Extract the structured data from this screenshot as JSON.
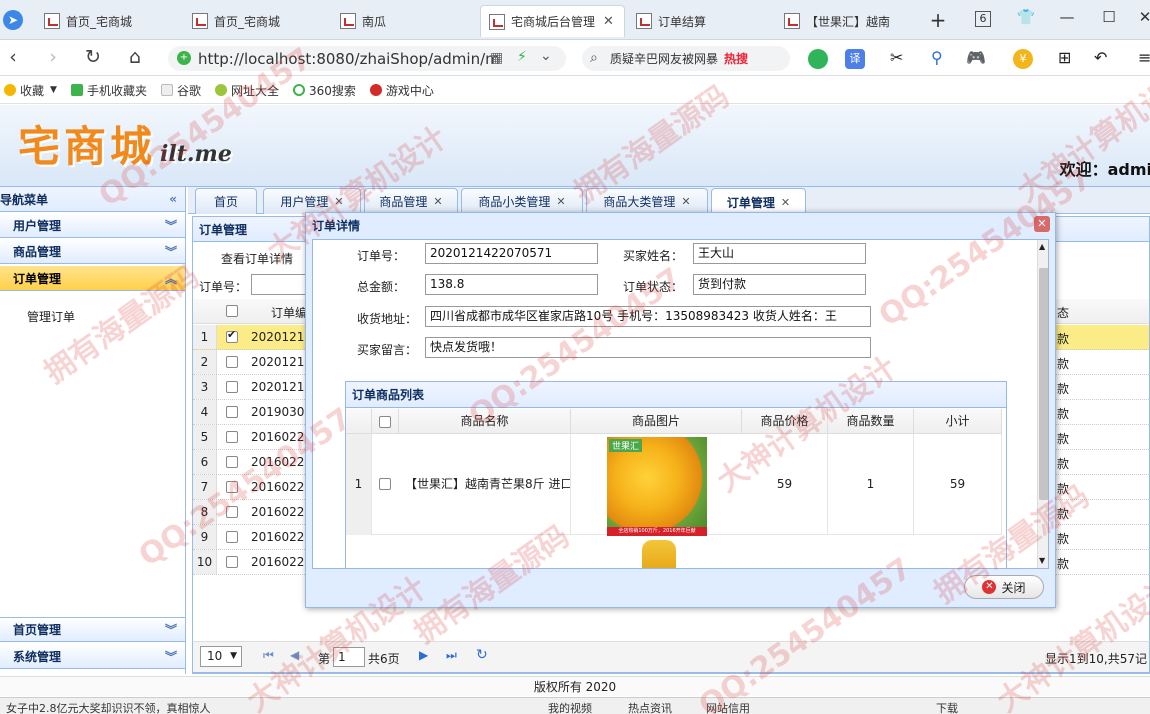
{
  "browser": {
    "tabs": [
      {
        "label": "首页_宅商城",
        "active": false
      },
      {
        "label": "首页_宅商城",
        "active": false
      },
      {
        "label": "南瓜",
        "active": false
      },
      {
        "label": "宅商城后台管理",
        "active": true
      },
      {
        "label": "订单结算",
        "active": false
      },
      {
        "label": "【世果汇】越南",
        "active": false
      }
    ],
    "tab_count": "6",
    "url": "http://localhost:8080/zhaiShop/admin/m",
    "search_text": "质疑辛巴网友被网暴",
    "search_hot": "热搜",
    "bookmarks": [
      "收藏",
      "手机收藏夹",
      "谷歌",
      "网址大全",
      "360搜索",
      "游戏中心"
    ]
  },
  "header": {
    "logo_text": "宅商城",
    "logo_sub": "ilt.me",
    "welcome": "欢迎：admi"
  },
  "left_menu": {
    "title": "导航菜单",
    "groups": [
      {
        "label": "用户管理"
      },
      {
        "label": "商品管理"
      },
      {
        "label": "订单管理"
      },
      {
        "label": "首页管理"
      },
      {
        "label": "系统管理"
      }
    ],
    "sub_item": "管理订单"
  },
  "main_tabs": [
    {
      "label": "首页",
      "closable": false
    },
    {
      "label": "用户管理",
      "closable": true
    },
    {
      "label": "商品管理",
      "closable": true
    },
    {
      "label": "商品小类管理",
      "closable": true
    },
    {
      "label": "商品大类管理",
      "closable": true
    },
    {
      "label": "订单管理",
      "closable": true
    }
  ],
  "order_panel": {
    "title": "订单管理",
    "view_detail": "查看订单详情",
    "order_no_label": "订单号：",
    "col_code": "订单编",
    "col_status": "态",
    "rows": [
      {
        "n": "1",
        "code": "2020121",
        "status": "款",
        "checked": true
      },
      {
        "n": "2",
        "code": "2020121",
        "status": "款",
        "checked": false
      },
      {
        "n": "3",
        "code": "2020121",
        "status": "款",
        "checked": false
      },
      {
        "n": "4",
        "code": "2019030",
        "status": "款",
        "checked": false
      },
      {
        "n": "5",
        "code": "2016022",
        "status": "款",
        "checked": false
      },
      {
        "n": "6",
        "code": "2016022",
        "status": "款",
        "checked": false
      },
      {
        "n": "7",
        "code": "2016022",
        "status": "款",
        "checked": false
      },
      {
        "n": "8",
        "code": "2016022",
        "status": "款",
        "checked": false
      },
      {
        "n": "9",
        "code": "2016022",
        "status": "款",
        "checked": false
      },
      {
        "n": "10",
        "code": "2016022",
        "status": "款",
        "checked": false
      }
    ]
  },
  "pager": {
    "page_size": "10",
    "page_prefix": "第",
    "page_value": "1",
    "page_total": "共6页",
    "summary": "显示1到10,共57记"
  },
  "footer": {
    "copyright": "版权所有 2020"
  },
  "statusbar": {
    "left": "女子中2.8亿元大奖却识识不领，真相惊人",
    "items": [
      "我的视频",
      "热点资讯",
      "网站信用",
      "下载"
    ]
  },
  "modal": {
    "title": "订单详情",
    "fields": {
      "order_no_label": "订单号：",
      "order_no": "2020121422070571",
      "buyer_label": "买家姓名：",
      "buyer": "王大山",
      "total_label": "总金额：",
      "total": "138.8",
      "status_label": "订单状态：",
      "status": "货到付款",
      "address_label": "收货地址：",
      "address": "四川省成都市成华区崔家店路10号  手机号：13508983423  收货人姓名：王",
      "message_label": "买家留言：",
      "message": "快点发货哦！"
    },
    "goods": {
      "title": "订单商品列表",
      "headers": {
        "name": "商品名称",
        "image": "商品图片",
        "price": "商品价格",
        "qty": "商品数量",
        "subtotal": "小计"
      },
      "rows": [
        {
          "n": "1",
          "name": "【世果汇】越南青芒果8斤 进口",
          "price": "59",
          "qty": "1",
          "subtotal": "59",
          "img_tag": "世果汇",
          "img_band": "全店热销100万斤，2016开年巨献"
        }
      ]
    },
    "close_button": "关闭"
  },
  "watermarks": [
    "QQ:254540457",
    "拥有海量源码",
    "大神计算机设计"
  ]
}
